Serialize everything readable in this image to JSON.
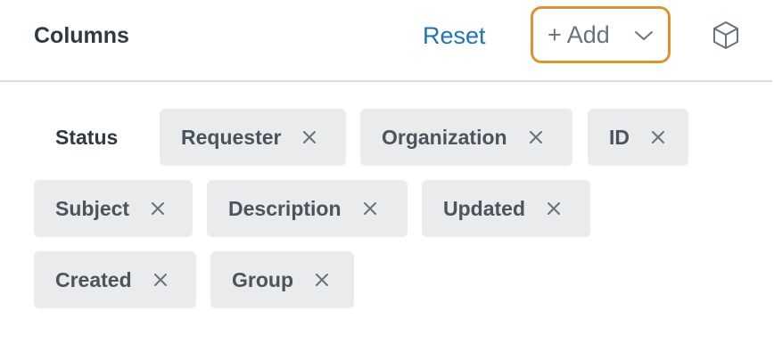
{
  "header": {
    "title": "Columns",
    "reset_label": "Reset",
    "add_label": "+ Add",
    "add_icon": "chevron-down-icon",
    "side_icon": "cube-icon"
  },
  "static_column": {
    "label": "Status"
  },
  "tags": [
    {
      "label": "Requester",
      "remove_icon": "close-icon"
    },
    {
      "label": "Organization",
      "remove_icon": "close-icon"
    },
    {
      "label": "ID",
      "remove_icon": "close-icon"
    },
    {
      "label": "Subject",
      "remove_icon": "close-icon"
    },
    {
      "label": "Description",
      "remove_icon": "close-icon"
    },
    {
      "label": "Updated",
      "remove_icon": "close-icon"
    },
    {
      "label": "Created",
      "remove_icon": "close-icon"
    },
    {
      "label": "Group",
      "remove_icon": "close-icon"
    }
  ],
  "colors": {
    "accent_link": "#1f73b7",
    "focus_ring": "#e0922d",
    "tag_background": "#e9ebed",
    "text_primary": "#2f3941",
    "text_muted": "#68737d"
  }
}
